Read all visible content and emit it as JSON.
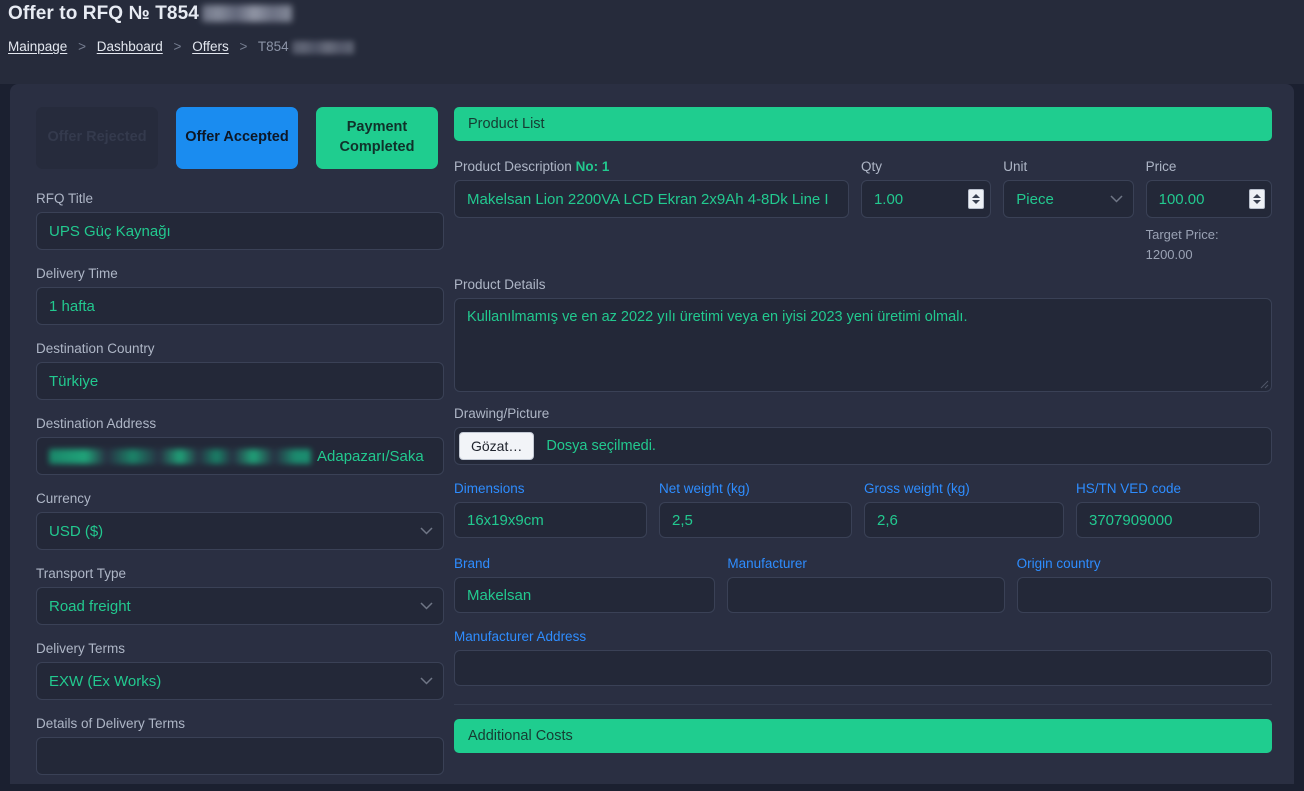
{
  "header": {
    "title_prefix": "Offer to RFQ № T854",
    "breadcrumb": {
      "mainpage": "Mainpage",
      "dashboard": "Dashboard",
      "offers": "Offers",
      "current": "T854",
      "separator": ">"
    }
  },
  "status_buttons": [
    {
      "label": "Offer Rejected",
      "state": "disabled",
      "color": "#262b3c"
    },
    {
      "label": "Offer Accepted",
      "state": "active",
      "color": "#1a8cf0"
    },
    {
      "label": "Payment Completed",
      "state": "active",
      "color": "#1fcd8f"
    }
  ],
  "left_form": {
    "rfq_title": {
      "label": "RFQ Title",
      "value": "UPS Güç Kaynağı"
    },
    "delivery_time": {
      "label": "Delivery Time",
      "value": "1 hafta"
    },
    "destination_country": {
      "label": "Destination Country",
      "value": "Türkiye"
    },
    "destination_address": {
      "label": "Destination Address",
      "value": "Adapazarı/Saka",
      "redacted": true
    },
    "currency": {
      "label": "Currency",
      "value": "USD ($)"
    },
    "transport_type": {
      "label": "Transport Type",
      "value": "Road freight"
    },
    "delivery_terms": {
      "label": "Delivery Terms",
      "value": "EXW (Ex Works)"
    },
    "details_of_delivery_terms": {
      "label": "Details of Delivery Terms",
      "value": ""
    }
  },
  "right_form": {
    "product_list_header": "Product List",
    "additional_costs_header": "Additional Costs",
    "product_description": {
      "label": "Product Description",
      "no_label": "No: 1",
      "value": "Makelsan Lion 2200VA LCD Ekran 2x9Ah 4-8Dk Line I"
    },
    "qty": {
      "label": "Qty",
      "value": "1.00"
    },
    "unit": {
      "label": "Unit",
      "value": "Piece"
    },
    "price": {
      "label": "Price",
      "value": "100.00"
    },
    "target_price": {
      "label": "Target Price:",
      "value": "1200.00"
    },
    "product_details": {
      "label": "Product Details",
      "value": "Kullanılmamış ve en az 2022 yılı üretimi veya en iyisi 2023 yeni üretimi olmalı."
    },
    "drawing_picture": {
      "label": "Drawing/Picture",
      "browse_label": "Gözat…",
      "file_status": "Dosya seçilmedi."
    },
    "dimensions": {
      "label": "Dimensions",
      "value": "16x19x9cm"
    },
    "net_weight": {
      "label": "Net weight (kg)",
      "value": "2,5"
    },
    "gross_weight": {
      "label": "Gross weight (kg)",
      "value": "2,6"
    },
    "hs_code": {
      "label": "HS/TN VED code",
      "value": "3707909000"
    },
    "brand": {
      "label": "Brand",
      "value": "Makelsan"
    },
    "manufacturer": {
      "label": "Manufacturer",
      "value": ""
    },
    "origin_country": {
      "label": "Origin country",
      "value": ""
    },
    "manufacturer_address": {
      "label": "Manufacturer Address",
      "value": ""
    }
  },
  "colors": {
    "page_background": "#1b2030",
    "card_background": "#2a2f42",
    "header_background": "#262b3b",
    "input_background": "#232838",
    "accent_green": "#1fcd8f",
    "accent_blue": "#1a8cf0",
    "label_blue": "#2e8dff",
    "value_green": "#22c98f",
    "label_grey": "#aeb6c6"
  }
}
